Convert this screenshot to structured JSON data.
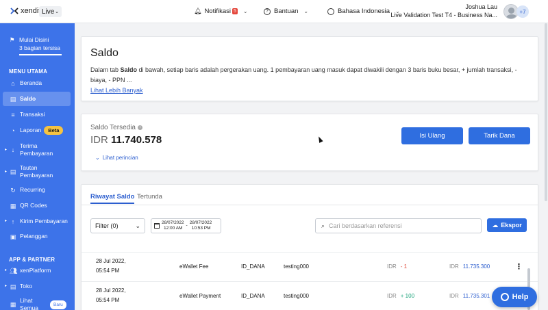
{
  "topbar": {
    "logo_text": "xendit",
    "env": "Live",
    "notifications_label": "Notifikasi",
    "notifications_count": "5",
    "help_label": "Bantuan",
    "language_label": "Bahasa Indonesia",
    "user_name": "Joshua Lau",
    "business_name": "Live Validation Test T4 - Business Na...",
    "extra_accounts": "+7"
  },
  "sidebar": {
    "progress_title": "Mulai Disini",
    "progress_sub": "3 bagian tersisa",
    "section_main": "MENU UTAMA",
    "items": [
      {
        "label": "Beranda",
        "icon": "home-icon"
      },
      {
        "label": "Saldo",
        "icon": "document-icon"
      },
      {
        "label": "Transaksi",
        "icon": "database-icon"
      },
      {
        "label": "Laporan",
        "icon": "chart-icon",
        "badge": "Beta"
      },
      {
        "label": "Terima Pembayaran",
        "icon": "receive-icon"
      },
      {
        "label": "Tautan Pembayaran",
        "icon": "link-icon"
      },
      {
        "label": "Recurring",
        "icon": "recurring-icon"
      },
      {
        "label": "QR Codes",
        "icon": "qr-icon"
      },
      {
        "label": "Kirim Pembayaran",
        "icon": "send-icon"
      },
      {
        "label": "Pelanggan",
        "icon": "customer-icon"
      }
    ],
    "section_partner": "APP & PARTNER",
    "partner_items": [
      {
        "label": "xenPlatform",
        "icon": "people-icon"
      },
      {
        "label": "Toko",
        "icon": "store-icon"
      },
      {
        "label": "Lihat Semua",
        "icon": "grid-icon",
        "badge": "Baru"
      }
    ]
  },
  "saldo": {
    "title": "Saldo",
    "desc_pre": "Dalam tab ",
    "desc_bold": "Saldo",
    "desc_post": " di bawah, setiap baris adalah pergerakan uang. 1 pembayaran uang masuk dapat diwakili dengan 3 baris buku besar, + jumlah transaksi, - biaya, - PPN ...",
    "more_link": "Lihat Lebih Banyak"
  },
  "balance": {
    "label": "Saldo Tersedia",
    "currency": "IDR",
    "amount": "11.740.578",
    "detail_link": "Lihat perincian",
    "topup_button": "Isi Ulang",
    "withdraw_button": "Tarik Dana"
  },
  "history": {
    "tab_active": "Riwayat Saldo",
    "tab_pending": "Tertunda",
    "filter_label": "Filter (0)",
    "date_start": "28/07/2022",
    "time_start": "12:00 AM",
    "date_end": "28/07/2022",
    "time_end": "10:53 PM",
    "search_placeholder": "Cari berdasarkan referensi",
    "export_button": "Ekspor",
    "rows": [
      {
        "date": "28 Jul 2022,",
        "time": "05:54 PM",
        "type": "eWallet Fee",
        "channel": "ID_DANA",
        "ref": "testing000",
        "amount_cur": "IDR",
        "amount": "- 1",
        "sign": "neg",
        "balance_cur": "IDR",
        "balance": "11.735.300"
      },
      {
        "date": "28 Jul 2022,",
        "time": "05:54 PM",
        "type": "eWallet Payment",
        "channel": "ID_DANA",
        "ref": "testing000",
        "amount_cur": "IDR",
        "amount": "+ 100",
        "sign": "pos",
        "balance_cur": "IDR",
        "balance": "11.735.301"
      }
    ]
  },
  "help_button": "Help"
}
